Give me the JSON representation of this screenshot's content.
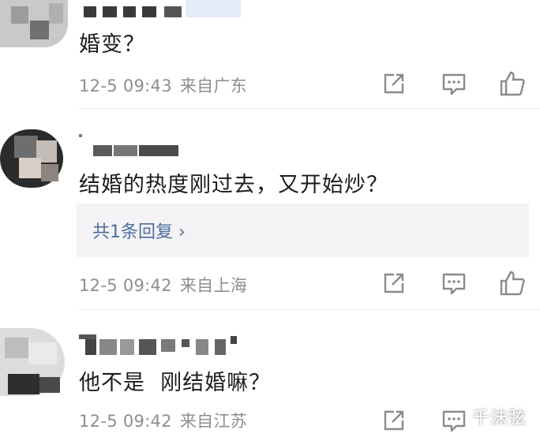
{
  "comments": [
    {
      "text": "婚变？",
      "time": "12-5 09:43",
      "location": "来自广东"
    },
    {
      "text": "结婚的热度刚过去，又开始炒？",
      "reply_link": "共1条回复 ›",
      "time": "12-5 09:42",
      "location": "来自上海"
    },
    {
      "text": "他不是  刚结婚嘛？",
      "time": "12-5 09:42",
      "location": "来自江苏"
    }
  ],
  "actions": {
    "share_icon": "share-icon",
    "comment_icon": "comment-icon",
    "like_icon": "thumbs-up-icon",
    "icon_color": "#8a8a8a"
  },
  "watermark": "千沫弦"
}
